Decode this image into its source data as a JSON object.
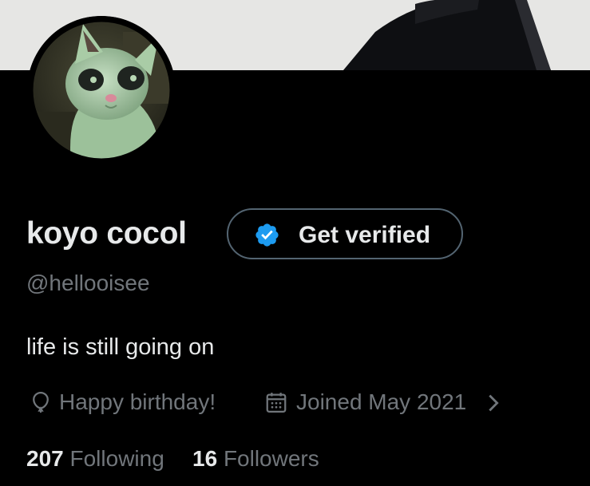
{
  "profile": {
    "display_name": "koyo cocol",
    "handle": "@hellooisee",
    "bio": "life is still going on",
    "verify_button_label": "Get verified",
    "birthday_text": "Happy birthday!",
    "joined_text": "Joined May 2021",
    "following_count": "207",
    "following_label": "Following",
    "followers_count": "16",
    "followers_label": "Followers"
  },
  "icons": {
    "verified": "verified-badge-icon",
    "birthday": "balloon-icon",
    "joined": "calendar-icon",
    "expand": "chevron-right-icon"
  },
  "colors": {
    "background": "#000000",
    "primary_text": "#e7e9ea",
    "secondary_text": "#71767b",
    "button_border": "#536471",
    "verified_blue": "#1d9bf0",
    "banner": "#e6e6e4"
  }
}
